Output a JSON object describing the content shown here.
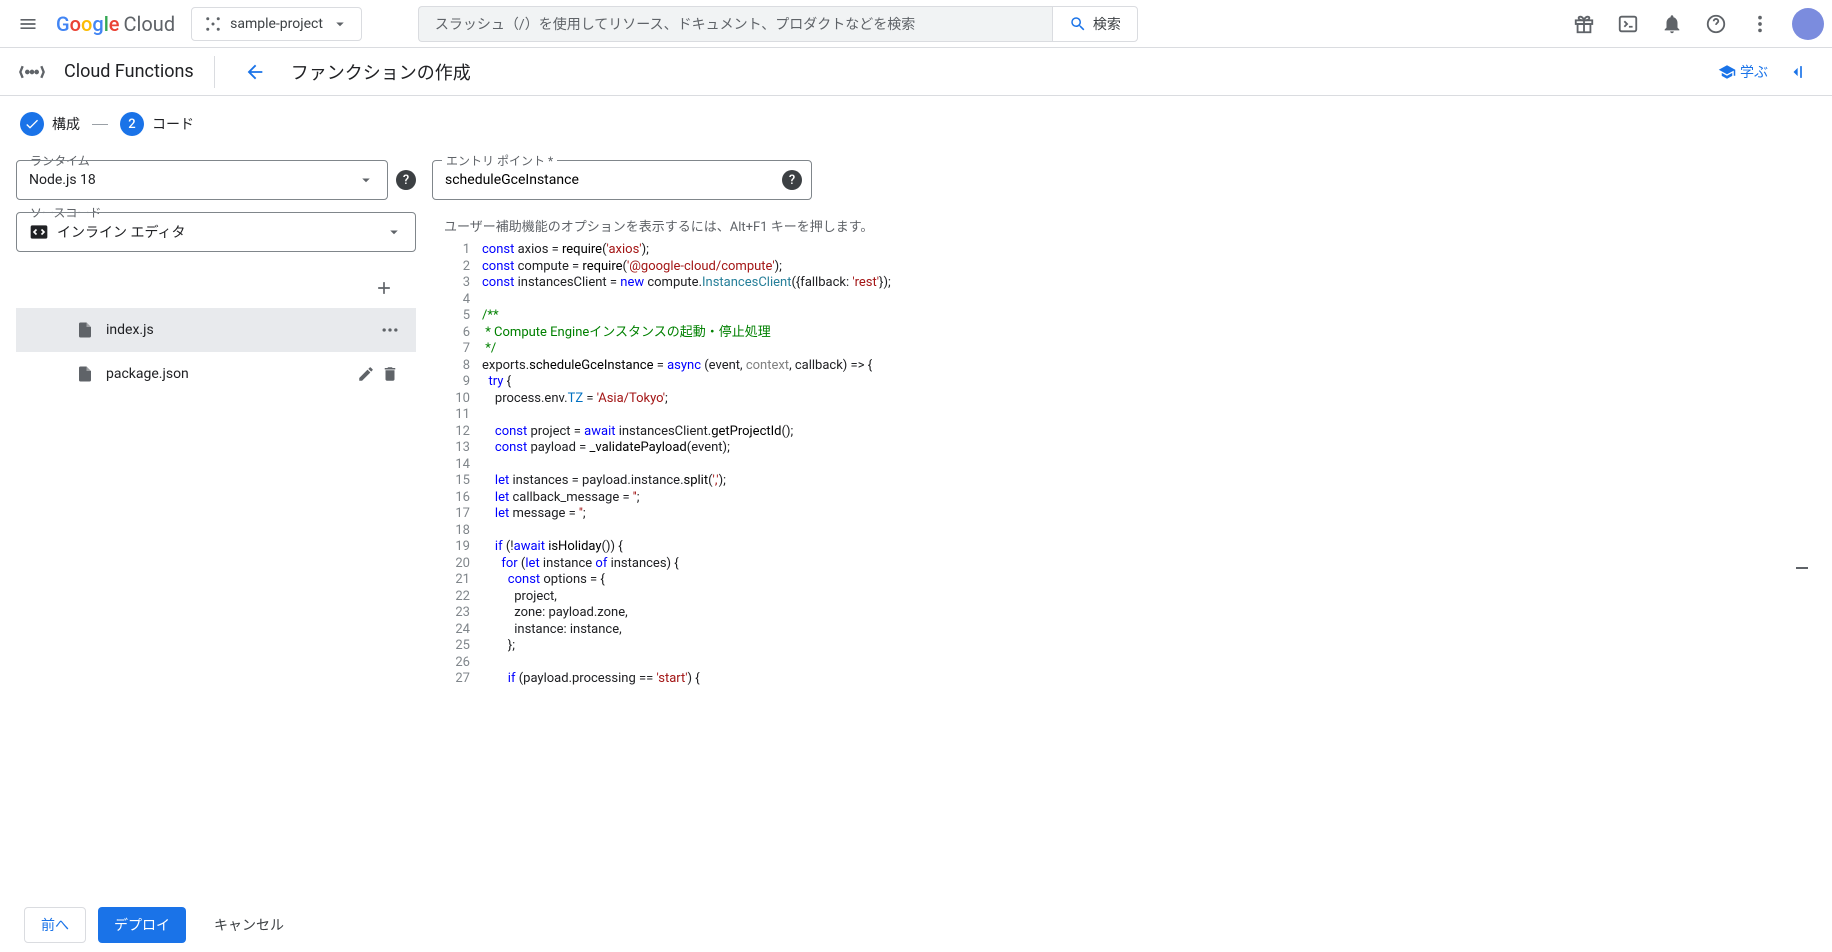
{
  "header": {
    "logo_text": "Google",
    "logo_suffix": "Cloud",
    "project_name": "sample-project",
    "search_placeholder": "スラッシュ（/）を使用してリソース、ドキュメント、プロダクトなどを検索",
    "search_button": "検索"
  },
  "subheader": {
    "product_name": "Cloud Functions",
    "page_title": "ファンクションの作成",
    "learn_label": "学ぶ"
  },
  "stepper": {
    "step1_label": "構成",
    "step2_number": "2",
    "step2_label": "コード"
  },
  "left": {
    "runtime_label": "ランタイム",
    "runtime_value": "Node.js 18",
    "source_label": "ソースコード",
    "source_value": "インライン エディタ",
    "files": [
      {
        "name": "index.js",
        "selected": true
      },
      {
        "name": "package.json",
        "selected": false
      }
    ]
  },
  "right": {
    "entry_label": "エントリ ポイント *",
    "entry_value": "scheduleGceInstance",
    "a11y_hint": "ユーザー補助機能のオプションを表示するには、Alt+F1 キーを押します。"
  },
  "code_lines": [
    [
      [
        "kw",
        "const"
      ],
      [
        "",
        " axios = "
      ],
      [
        "fn",
        "require"
      ],
      [
        "",
        "("
      ],
      [
        "str",
        "'axios'"
      ],
      [
        "",
        ");"
      ]
    ],
    [
      [
        "kw",
        "const"
      ],
      [
        "",
        " compute = "
      ],
      [
        "fn",
        "require"
      ],
      [
        "",
        "("
      ],
      [
        "str",
        "'@google-cloud/compute'"
      ],
      [
        "",
        ");"
      ]
    ],
    [
      [
        "kw",
        "const"
      ],
      [
        "",
        " instancesClient = "
      ],
      [
        "kw",
        "new"
      ],
      [
        "",
        " compute."
      ],
      [
        "cls",
        "InstancesClient"
      ],
      [
        "",
        "({fallback: "
      ],
      [
        "str",
        "'rest'"
      ],
      [
        "",
        "});"
      ]
    ],
    [],
    [
      [
        "cmt",
        "/**"
      ]
    ],
    [
      [
        "cmt",
        " * Compute Engineインスタンスの起動・停止処理"
      ]
    ],
    [
      [
        "cmt",
        " */"
      ]
    ],
    [
      [
        "",
        "exports."
      ],
      [
        "fn",
        "scheduleGceInstance"
      ],
      [
        "",
        " = "
      ],
      [
        "kw",
        "async"
      ],
      [
        "",
        " (event, "
      ],
      [
        "dim",
        "context"
      ],
      [
        "",
        ", callback) => {"
      ]
    ],
    [
      [
        "",
        "  "
      ],
      [
        "kw",
        "try"
      ],
      [
        "",
        " {"
      ]
    ],
    [
      [
        "",
        "    process.env."
      ],
      [
        "var",
        "TZ"
      ],
      [
        "",
        " = "
      ],
      [
        "str",
        "'Asia/Tokyo'"
      ],
      [
        "",
        ";"
      ]
    ],
    [],
    [
      [
        "",
        "    "
      ],
      [
        "kw",
        "const"
      ],
      [
        "",
        " project = "
      ],
      [
        "kw",
        "await"
      ],
      [
        "",
        " instancesClient."
      ],
      [
        "fn",
        "getProjectId"
      ],
      [
        "",
        "();"
      ]
    ],
    [
      [
        "",
        "    "
      ],
      [
        "kw",
        "const"
      ],
      [
        "",
        " payload = "
      ],
      [
        "fn",
        "_validatePayload"
      ],
      [
        "",
        "(event);"
      ]
    ],
    [],
    [
      [
        "",
        "    "
      ],
      [
        "kw",
        "let"
      ],
      [
        "",
        " instances = payload.instance."
      ],
      [
        "fn",
        "split"
      ],
      [
        "",
        "("
      ],
      [
        "str",
        "','"
      ],
      [
        "",
        ");"
      ]
    ],
    [
      [
        "",
        "    "
      ],
      [
        "kw",
        "let"
      ],
      [
        "",
        " callback_message = "
      ],
      [
        "str",
        "''"
      ],
      [
        "",
        ";"
      ]
    ],
    [
      [
        "",
        "    "
      ],
      [
        "kw",
        "let"
      ],
      [
        "",
        " message = "
      ],
      [
        "str",
        "''"
      ],
      [
        "",
        ";"
      ]
    ],
    [],
    [
      [
        "",
        "    "
      ],
      [
        "kw",
        "if"
      ],
      [
        "",
        " (!"
      ],
      [
        "kw",
        "await"
      ],
      [
        "",
        " "
      ],
      [
        "fn",
        "isHoliday"
      ],
      [
        "",
        "()) {"
      ]
    ],
    [
      [
        "",
        "      "
      ],
      [
        "kw",
        "for"
      ],
      [
        "",
        " ("
      ],
      [
        "kw",
        "let"
      ],
      [
        "",
        " instance "
      ],
      [
        "kw",
        "of"
      ],
      [
        "",
        " instances) {"
      ]
    ],
    [
      [
        "",
        "        "
      ],
      [
        "kw",
        "const"
      ],
      [
        "",
        " options = {"
      ]
    ],
    [
      [
        "",
        "          project,"
      ]
    ],
    [
      [
        "",
        "          zone: payload.zone,"
      ]
    ],
    [
      [
        "",
        "          instance: instance,"
      ]
    ],
    [
      [
        "",
        "        };"
      ]
    ],
    [],
    [
      [
        "",
        "        "
      ],
      [
        "kw",
        "if"
      ],
      [
        "",
        " (payload.processing == "
      ],
      [
        "str",
        "'start'"
      ],
      [
        "",
        ") {"
      ]
    ]
  ],
  "footer": {
    "prev": "前へ",
    "deploy": "デプロイ",
    "cancel": "キャンセル"
  }
}
